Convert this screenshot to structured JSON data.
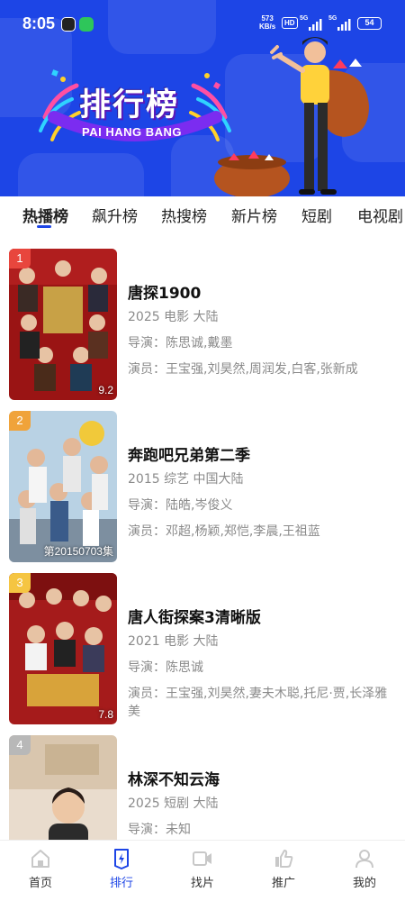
{
  "status_bar": {
    "time": "8:05",
    "net_speed_value": "573",
    "net_speed_unit": "KB/s",
    "hd": "HD",
    "signal_1": "5G",
    "signal_2": "5G",
    "battery": "54"
  },
  "banner": {
    "title": "排行榜",
    "subtitle": "PAI HANG BANG",
    "bg_color": "#1d45e6"
  },
  "tabs": [
    {
      "label": "热播榜",
      "active": true
    },
    {
      "label": "飙升榜",
      "active": false
    },
    {
      "label": "热搜榜",
      "active": false
    },
    {
      "label": "新片榜",
      "active": false
    },
    {
      "label": "短剧",
      "active": false
    },
    {
      "label": "电视剧",
      "active": false
    }
  ],
  "items": [
    {
      "rank": "1",
      "rank_color": "#e8463d",
      "title": "唐探1900",
      "meta": "2025 电影 大陆",
      "director": "导演：陈思诚,戴墨",
      "actors": "演员：王宝强,刘昊然,周润发,白客,张新成",
      "poster_note": "9.2"
    },
    {
      "rank": "2",
      "rank_color": "#f0a33a",
      "title": "奔跑吧兄弟第二季",
      "meta": "2015 综艺 中国大陆",
      "director": "导演：陆皓,岑俊义",
      "actors": "演员：邓超,杨颖,郑恺,李晨,王祖蓝",
      "poster_note": "第20150703集"
    },
    {
      "rank": "3",
      "rank_color": "#f5c542",
      "title": "唐人街探案3清晰版",
      "meta": "2021 电影 大陆",
      "director": "导演：陈思诚",
      "actors": "演员：王宝强,刘昊然,妻夫木聪,托尼·贾,长泽雅美",
      "poster_note": "7.8"
    },
    {
      "rank": "4",
      "rank_color": "#b8b8b8",
      "title": "林深不知云海",
      "meta": "2025 短剧 大陆",
      "director": "导演：未知",
      "actors": "",
      "poster_note": ""
    }
  ],
  "bottom_nav": [
    {
      "label": "首页",
      "icon": "home-icon",
      "active": false
    },
    {
      "label": "排行",
      "icon": "ranking-icon",
      "active": true
    },
    {
      "label": "找片",
      "icon": "video-camera-icon",
      "active": false
    },
    {
      "label": "推广",
      "icon": "thumbs-up-icon",
      "active": false
    },
    {
      "label": "我的",
      "icon": "user-icon",
      "active": false
    }
  ],
  "colors": {
    "accent": "#1d45e6",
    "inactive_icon": "#c8c8c8"
  }
}
